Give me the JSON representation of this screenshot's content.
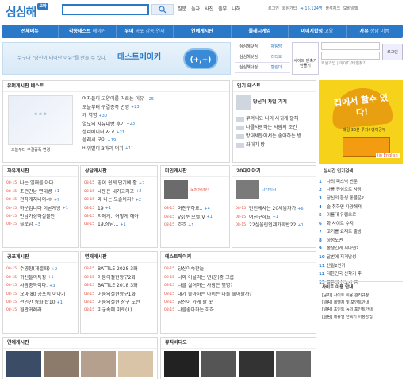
{
  "header": {
    "logo": "심심해",
    "logo_badge": "모바",
    "search_tabs": [
      "질문",
      "놀자",
      "사진",
      "출부",
      "나하"
    ],
    "top_links": [
      "로그인",
      "회원가입",
      "등 15,124명",
      "출석체크",
      "모바일웹"
    ]
  },
  "nav": [
    {
      "label": "전체메뉴",
      "sub": ""
    },
    {
      "label": "각종테스트",
      "sub": "메이커"
    },
    {
      "label": "유머",
      "sub": "공포 감동 연재"
    },
    {
      "label": "연예게시판",
      "sub": ""
    },
    {
      "label": "플래시게임",
      "sub": ""
    },
    {
      "label": "이미지합성",
      "sub": "고양"
    },
    {
      "label": "자유",
      "sub": "상담 이쁨"
    }
  ],
  "banner": {
    "text": "누구나 \"당신이 태어난 이유\"를 만들 수 있다.",
    "brand": "테스트메이커",
    "circle": "(+,+)"
  },
  "side_menu": [
    [
      "심심해닷컴",
      "채팅방"
    ],
    [
      "심심해닷컴",
      "라디오"
    ],
    [
      "심심해닷컴",
      "캘린더"
    ]
  ],
  "set_box": "사이트\n단축키만들기",
  "login": {
    "btn": "로그인",
    "links": "회원가입 | 아이디/비번찾기"
  },
  "best": {
    "title": "유머게시판 베스트",
    "caption": "오늘부터 구결증폭 변경",
    "items": [
      {
        "t": "여자들이 고양이를 거르는 이유",
        "c": "25"
      },
      {
        "t": "오늘부터 구결증폭 변경",
        "c": "23"
      },
      {
        "t": "개 역병",
        "c": "30"
      },
      {
        "t": "열도의 사유대방 후기",
        "c": "23"
      },
      {
        "t": "셀러베이터 사고",
        "c": "21"
      },
      {
        "t": "플래시 모이",
        "c": "19"
      },
      {
        "t": "바위벌이 3마리 먹기",
        "c": "11"
      }
    ]
  },
  "pop_test": {
    "title": "인기 테스트",
    "feature": "당신이 차일 가게",
    "items": [
      "무려사요 나의 사귀게 말해",
      "나를사랑하는 사람의 조건",
      "방대세분에서는 좋아하는 방",
      "좌대기 방"
    ]
  },
  "ad": {
    "title": "집에서 할수 있다!",
    "sub": "매일 30분 투자! 영어공부",
    "label": "Jin English"
  },
  "boards": [
    {
      "title": "자유게시판",
      "items": [
        "나는 일해를 아다.",
        "조건만남 연대병",
        "천하게지내여-ㅎ",
        "하운입니다 이론게방",
        "만남가성하실불안",
        "슬로남"
      ],
      "cnt": [
        "",
        "+1",
        "+7",
        "+1",
        "",
        "+3"
      ]
    },
    {
      "title": "상담게시판",
      "items": [
        "영어 쉽게 단기에 활",
        "내분은 내가고치고",
        "왜 나는 모솔이지?",
        "19",
        "저에게.. 어떻게 해야",
        "19,상담..."
      ],
      "cnt": [
        "+2",
        "+2",
        "+2",
        "+1",
        "",
        "+1"
      ]
    },
    {
      "title": "미인게시판",
      "items": [
        "여친구하요..",
        "Vs(준 모델)V",
        "흐흐"
      ],
      "cnt": [
        "+4",
        "+1",
        "+1"
      ],
      "card": "도발엄마빈"
    },
    {
      "title": "20대이야기",
      "items": [
        "민천에사는 20세남자가",
        "여친구하요",
        "22살울린인제가학반22"
      ],
      "cnt": [
        "+6",
        "+1",
        "+1"
      ],
      "card": "나가이사"
    },
    {
      "title": "공포게시판",
      "items": [
        "수영장(체셀화)",
        "귀신들의특징",
        "사람충득이다.",
        "요마 80 공포의 이야기",
        "전인만 영화 탑10",
        "월관귀례라"
      ],
      "cnt": [
        "+2",
        "+1",
        "+3",
        "",
        "+1",
        ""
      ]
    },
    {
      "title": "연재게시판",
      "items": [
        "BATTLE 2028 3화",
        "어둠의절현왕구2화",
        "BATTLE 2018 3화",
        "어둠의절현왕구1화",
        "어둠의절현 장구 도전",
        "미궁속에 미로(1)"
      ],
      "cnt": [
        "",
        "",
        "",
        "",
        "",
        ""
      ]
    },
    {
      "title": "테스트메이커",
      "items": [
        "당신이속한늘",
        "나와 어울리는 연(꾼)중 그룹",
        "나를 싫어하는 사람은 몇명?",
        "내가 좋아하는 아이는 나를 좋아할까?",
        "당신이 가게 할 꿋",
        "나를좋아하는 하하"
      ],
      "cnt": [
        "",
        "",
        "",
        "",
        "",
        ""
      ]
    }
  ],
  "rank": {
    "title": "실시간 인기검색",
    "items": [
      "나의 피스닉 씬문",
      "나를 진심으로 사랑",
      "당신의 환생 동물은?",
      "술 취하면 다양해져",
      "이를대 유럽으로",
      "화 사이트 수지",
      "고기를 요재로 출방",
      "하성도면",
      "몸생긴게 지나면?",
      "달번에 저게남성",
      "산월2인가",
      "대한민국 신학기 후",
      "몰론의 진도기 템"
    ]
  },
  "notice": {
    "title": "사이트 이용 안내",
    "items": [
      "[공지] 사이트 이용 관리규정",
      "[알림] 레벨제 및 포인트안내",
      "[알림] 포인트 등의 포인트안내",
      "[알림] 메뉴별 단축키 이용방법"
    ]
  },
  "bottom": {
    "left": "연예게시판",
    "right": "뮤직비디오"
  },
  "colors": {
    "brand": "#2a78c8",
    "accent": "#e24b3b",
    "ad": "#f7d21a"
  }
}
